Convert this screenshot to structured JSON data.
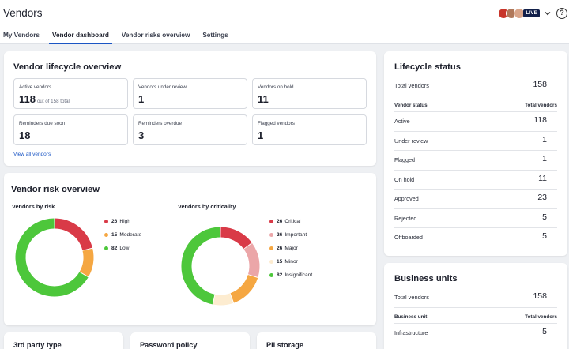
{
  "app": {
    "title": "Vendors"
  },
  "tabs": [
    {
      "label": "My Vendors"
    },
    {
      "label": "Vendor dashboard"
    },
    {
      "label": "Vendor risks overview"
    },
    {
      "label": "Settings"
    }
  ],
  "header": {
    "live_label": "LIVE",
    "help_glyph": "?"
  },
  "lifecycle_overview": {
    "title": "Vendor lifecycle overview",
    "stats": [
      {
        "label": "Active vendors",
        "value": "118",
        "sub": "out of 158 total"
      },
      {
        "label": "Vendors under review",
        "value": "1"
      },
      {
        "label": "Vendors on hold",
        "value": "11"
      },
      {
        "label": "Reminders due soon",
        "value": "18"
      },
      {
        "label": "Reminders overdue",
        "value": "3"
      },
      {
        "label": "Flagged vendors",
        "value": "1"
      }
    ],
    "view_all": "View all vendors"
  },
  "risk_overview": {
    "title": "Vendor risk overview",
    "chart_data": [
      {
        "type": "pie",
        "title": "Vendors by risk",
        "series": [
          {
            "name": "High",
            "value": 26,
            "color": "#d93a47"
          },
          {
            "name": "Moderate",
            "value": 15,
            "color": "#f5a742"
          },
          {
            "name": "Low",
            "value": 82,
            "color": "#4dc73b"
          }
        ]
      },
      {
        "type": "pie",
        "title": "Vendors by criticality",
        "series": [
          {
            "name": "Critical",
            "value": 26,
            "color": "#d93a47"
          },
          {
            "name": "Important",
            "value": 26,
            "color": "#eba6a8"
          },
          {
            "name": "Major",
            "value": 26,
            "color": "#f5a742"
          },
          {
            "name": "Minor",
            "value": 15,
            "color": "#fdecd0"
          },
          {
            "name": "Insignificant",
            "value": 82,
            "color": "#4dc73b"
          }
        ]
      }
    ]
  },
  "lifecycle_status": {
    "title": "Lifecycle status",
    "total_label": "Total vendors",
    "total_value": "158",
    "col_status": "Vendor status",
    "col_total": "Total vendors",
    "rows": [
      {
        "label": "Active",
        "value": "118"
      },
      {
        "label": "Under review",
        "value": "1"
      },
      {
        "label": "Flagged",
        "value": "1"
      },
      {
        "label": "On hold",
        "value": "11"
      },
      {
        "label": "Approved",
        "value": "23"
      },
      {
        "label": "Rejected",
        "value": "5"
      },
      {
        "label": "Offboarded",
        "value": "5"
      }
    ]
  },
  "business_units": {
    "title": "Business units",
    "total_label": "Total vendors",
    "total_value": "158",
    "col_unit": "Business unit",
    "col_total": "Total vendors",
    "rows": [
      {
        "label": "Infrastructure",
        "value": "5"
      }
    ]
  },
  "bottom_cards": [
    {
      "title": "3rd party type"
    },
    {
      "title": "Password policy"
    },
    {
      "title": "PII storage"
    }
  ]
}
